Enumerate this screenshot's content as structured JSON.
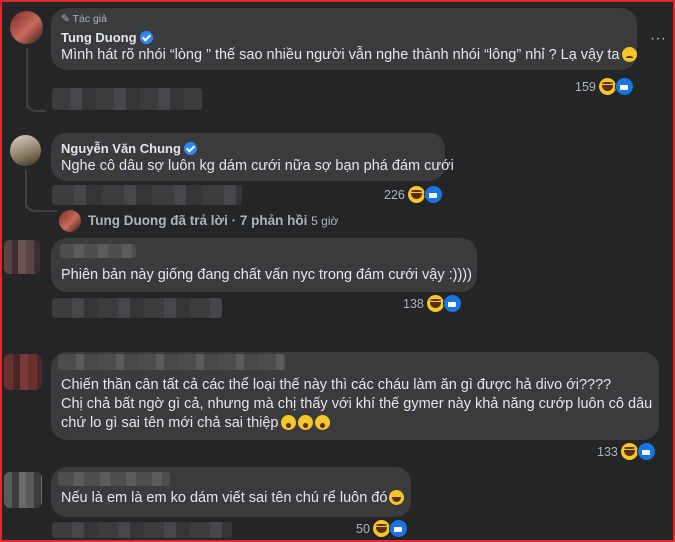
{
  "comments": [
    {
      "badge": "Tác giả",
      "author": "Tung Duong",
      "text": "Mình hát rõ nhói “lòng ” thế sao nhiều người vẫn nghe thành nhói “lông” nhỉ ? Lạ vậy ta",
      "reaction_count": "159"
    },
    {
      "author": "Nguyễn Văn Chung",
      "text": "Nghe cô dâu sợ luôn kg dám cưới nữa sợ bạn phá đám cưới",
      "reaction_count": "226"
    },
    {
      "text": "Phiên bản này giống đang chất vấn nyc trong đám cưới vậy :))))",
      "reaction_count": "138"
    },
    {
      "line1": "Chiến thần cân tất cả các thể loại thế này thì các cháu làm ăn gì được hả divo ới????",
      "line2": "Chị chả bất ngờ gì cả, nhưng mà chị thấy với khí thế gymer này khả năng cướp luôn cô dâu",
      "line3": "chứ lo gì sai tên mới chả sai thiệp",
      "reaction_count": "133"
    },
    {
      "text": "Nếu là em là em ko dám viết sai tên chú rể luôn đó",
      "reaction_count": "50"
    }
  ],
  "reply_summary": {
    "author": "Tung Duong",
    "action": "đã trả lời",
    "separator": "·",
    "replies": "7 phản hồi",
    "time": "5 giờ"
  },
  "more_menu": "···"
}
